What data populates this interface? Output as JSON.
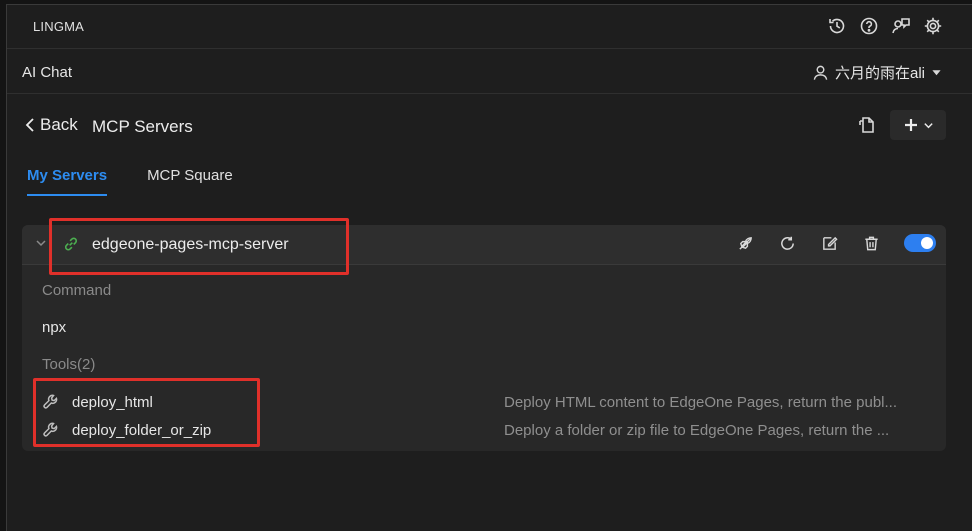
{
  "app": {
    "title": "LINGMA"
  },
  "top_icons": [
    "history-icon",
    "help-icon",
    "feedback-icon",
    "settings-icon"
  ],
  "chat": {
    "title": "AI Chat"
  },
  "user": {
    "name": "六月的雨在ali"
  },
  "header": {
    "back_label": "Back",
    "title": "MCP Servers"
  },
  "tabs": [
    {
      "label": "My Servers",
      "active": true
    },
    {
      "label": "MCP Square",
      "active": false
    }
  ],
  "server": {
    "name": "edgeone-pages-mcp-server",
    "enabled": true,
    "command_label": "Command",
    "command_value": "npx",
    "tools_label": "Tools(2)",
    "tools": [
      {
        "name": "deploy_html",
        "description": "Deploy HTML content to EdgeOne Pages, return the publ..."
      },
      {
        "name": "deploy_folder_or_zip",
        "description": "Deploy a folder or zip file to EdgeOne Pages, return the ..."
      }
    ]
  },
  "colors": {
    "accent": "#2d8cf0",
    "highlight_box": "#e0302a",
    "link_icon": "#4caf50"
  }
}
